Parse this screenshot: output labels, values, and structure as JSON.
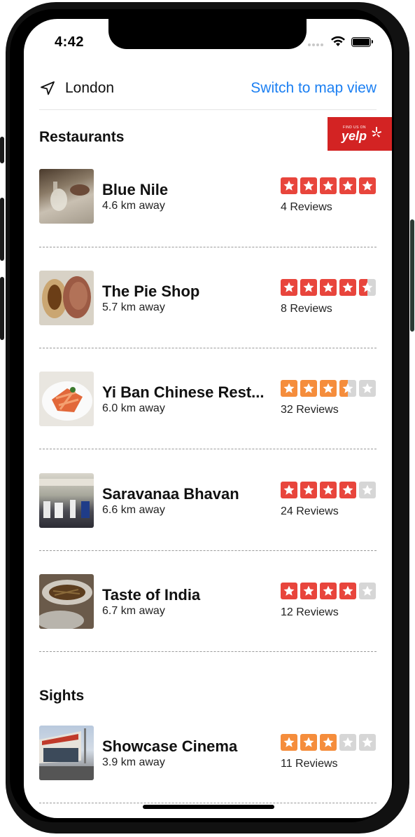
{
  "status_bar": {
    "time": "4:42"
  },
  "location": {
    "city": "London",
    "map_toggle": "Switch to map view"
  },
  "yelp_badge": {
    "small_text": "FIND US ON",
    "brand": "yelp"
  },
  "sections": {
    "restaurants": {
      "title": "Restaurants"
    },
    "sights": {
      "title": "Sights"
    }
  },
  "colors": {
    "rating_high": "#e8453c",
    "rating_mid": "#f58d3c",
    "star_empty": "#d6d6d6",
    "link": "#1b7ff2",
    "yelp_red": "#d32323"
  },
  "restaurants": [
    {
      "name": "Blue Nile",
      "distance": "4.6 km away",
      "rating": 5,
      "reviews": "4 Reviews",
      "thumb": "food-table-photo"
    },
    {
      "name": "The Pie Shop",
      "distance": "5.7 km away",
      "rating": 4.5,
      "reviews": "8 Reviews",
      "thumb": "pie-photo"
    },
    {
      "name": "Yi Ban Chinese Rest...",
      "distance": "6.0 km away",
      "rating": 3.5,
      "reviews": "32 Reviews",
      "thumb": "noodle-photo"
    },
    {
      "name": "Saravanaa Bhavan",
      "distance": "6.6 km away",
      "rating": 4,
      "reviews": "24 Reviews",
      "thumb": "dining-room-photo"
    },
    {
      "name": "Taste of India",
      "distance": "6.7 km away",
      "rating": 4,
      "reviews": "12 Reviews",
      "thumb": "curry-dish-photo"
    }
  ],
  "sights": [
    {
      "name": "Showcase Cinema",
      "distance": "3.9 km away",
      "rating": 3,
      "reviews": "11 Reviews",
      "thumb": "cinema-building-photo"
    }
  ]
}
